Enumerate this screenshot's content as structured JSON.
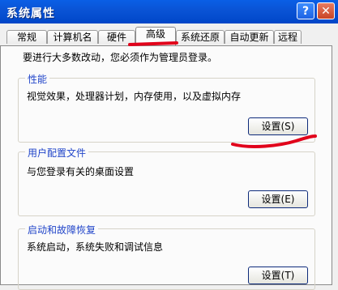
{
  "window": {
    "title": "系统属性",
    "help_label": "?",
    "close_label": "✕"
  },
  "tabs": [
    {
      "label": "常规"
    },
    {
      "label": "计算机名"
    },
    {
      "label": "硬件"
    },
    {
      "label": "高级",
      "active": true
    },
    {
      "label": "系统还原"
    },
    {
      "label": "自动更新"
    },
    {
      "label": "远程"
    }
  ],
  "intro": "要进行大多数改动，您必须作为管理员登录。",
  "groups": [
    {
      "legend": "性能",
      "description": "视觉效果，处理器计划，内存使用，以及虚拟内存",
      "button": "设置(S)"
    },
    {
      "legend": "用户配置文件",
      "description": "与您登录有关的桌面设置",
      "button": "设置(E)"
    },
    {
      "legend": "启动和故障恢复",
      "description": "系统启动，系统失败和调试信息",
      "button": "设置(T)"
    }
  ],
  "colors": {
    "titlebar": "#0a54d6",
    "annotation": "#e1001a",
    "legend_text": "#2145c9"
  }
}
